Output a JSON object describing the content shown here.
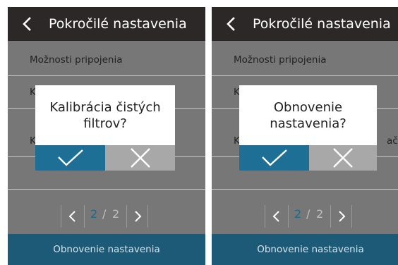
{
  "colors": {
    "header_bg": "#2b2827",
    "screen_bg": "#777777",
    "footer_bg": "#1c5a77",
    "confirm_bg": "#1e6f96",
    "cancel_bg": "#a8a8a8",
    "page_current": "#1d6a8c"
  },
  "screens": [
    {
      "header": {
        "back_icon": "chevron-left-icon",
        "title": "Pokročilé nastavenia"
      },
      "list": {
        "items": [
          {
            "label": "Možnosti pripojenia"
          },
          {
            "label": "K"
          },
          {
            "label": "K"
          }
        ],
        "trailing_fragment": ""
      },
      "dialog": {
        "line1": "Kalibrácia čistých",
        "line2": "filtrov?",
        "confirm_icon": "check-icon",
        "cancel_icon": "close-icon"
      },
      "pager": {
        "current": "2",
        "separator": "/",
        "total": "2",
        "prev_icon": "chevron-left-icon",
        "next_icon": "chevron-right-icon"
      },
      "footer": {
        "label": "Obnovenie nastavenia"
      }
    },
    {
      "header": {
        "back_icon": "chevron-left-icon",
        "title": "Pokročilé nastavenia"
      },
      "list": {
        "items": [
          {
            "label": "Možnosti pripojenia"
          },
          {
            "label": "K"
          },
          {
            "label": "K"
          }
        ],
        "trailing_fragment": "ači"
      },
      "dialog": {
        "line1": "Obnovenie",
        "line2": "nastavenia?",
        "confirm_icon": "check-icon",
        "cancel_icon": "close-icon"
      },
      "pager": {
        "current": "2",
        "separator": "/",
        "total": "2",
        "prev_icon": "chevron-left-icon",
        "next_icon": "chevron-right-icon"
      },
      "footer": {
        "label": "Obnovenie nastavenia"
      }
    }
  ]
}
